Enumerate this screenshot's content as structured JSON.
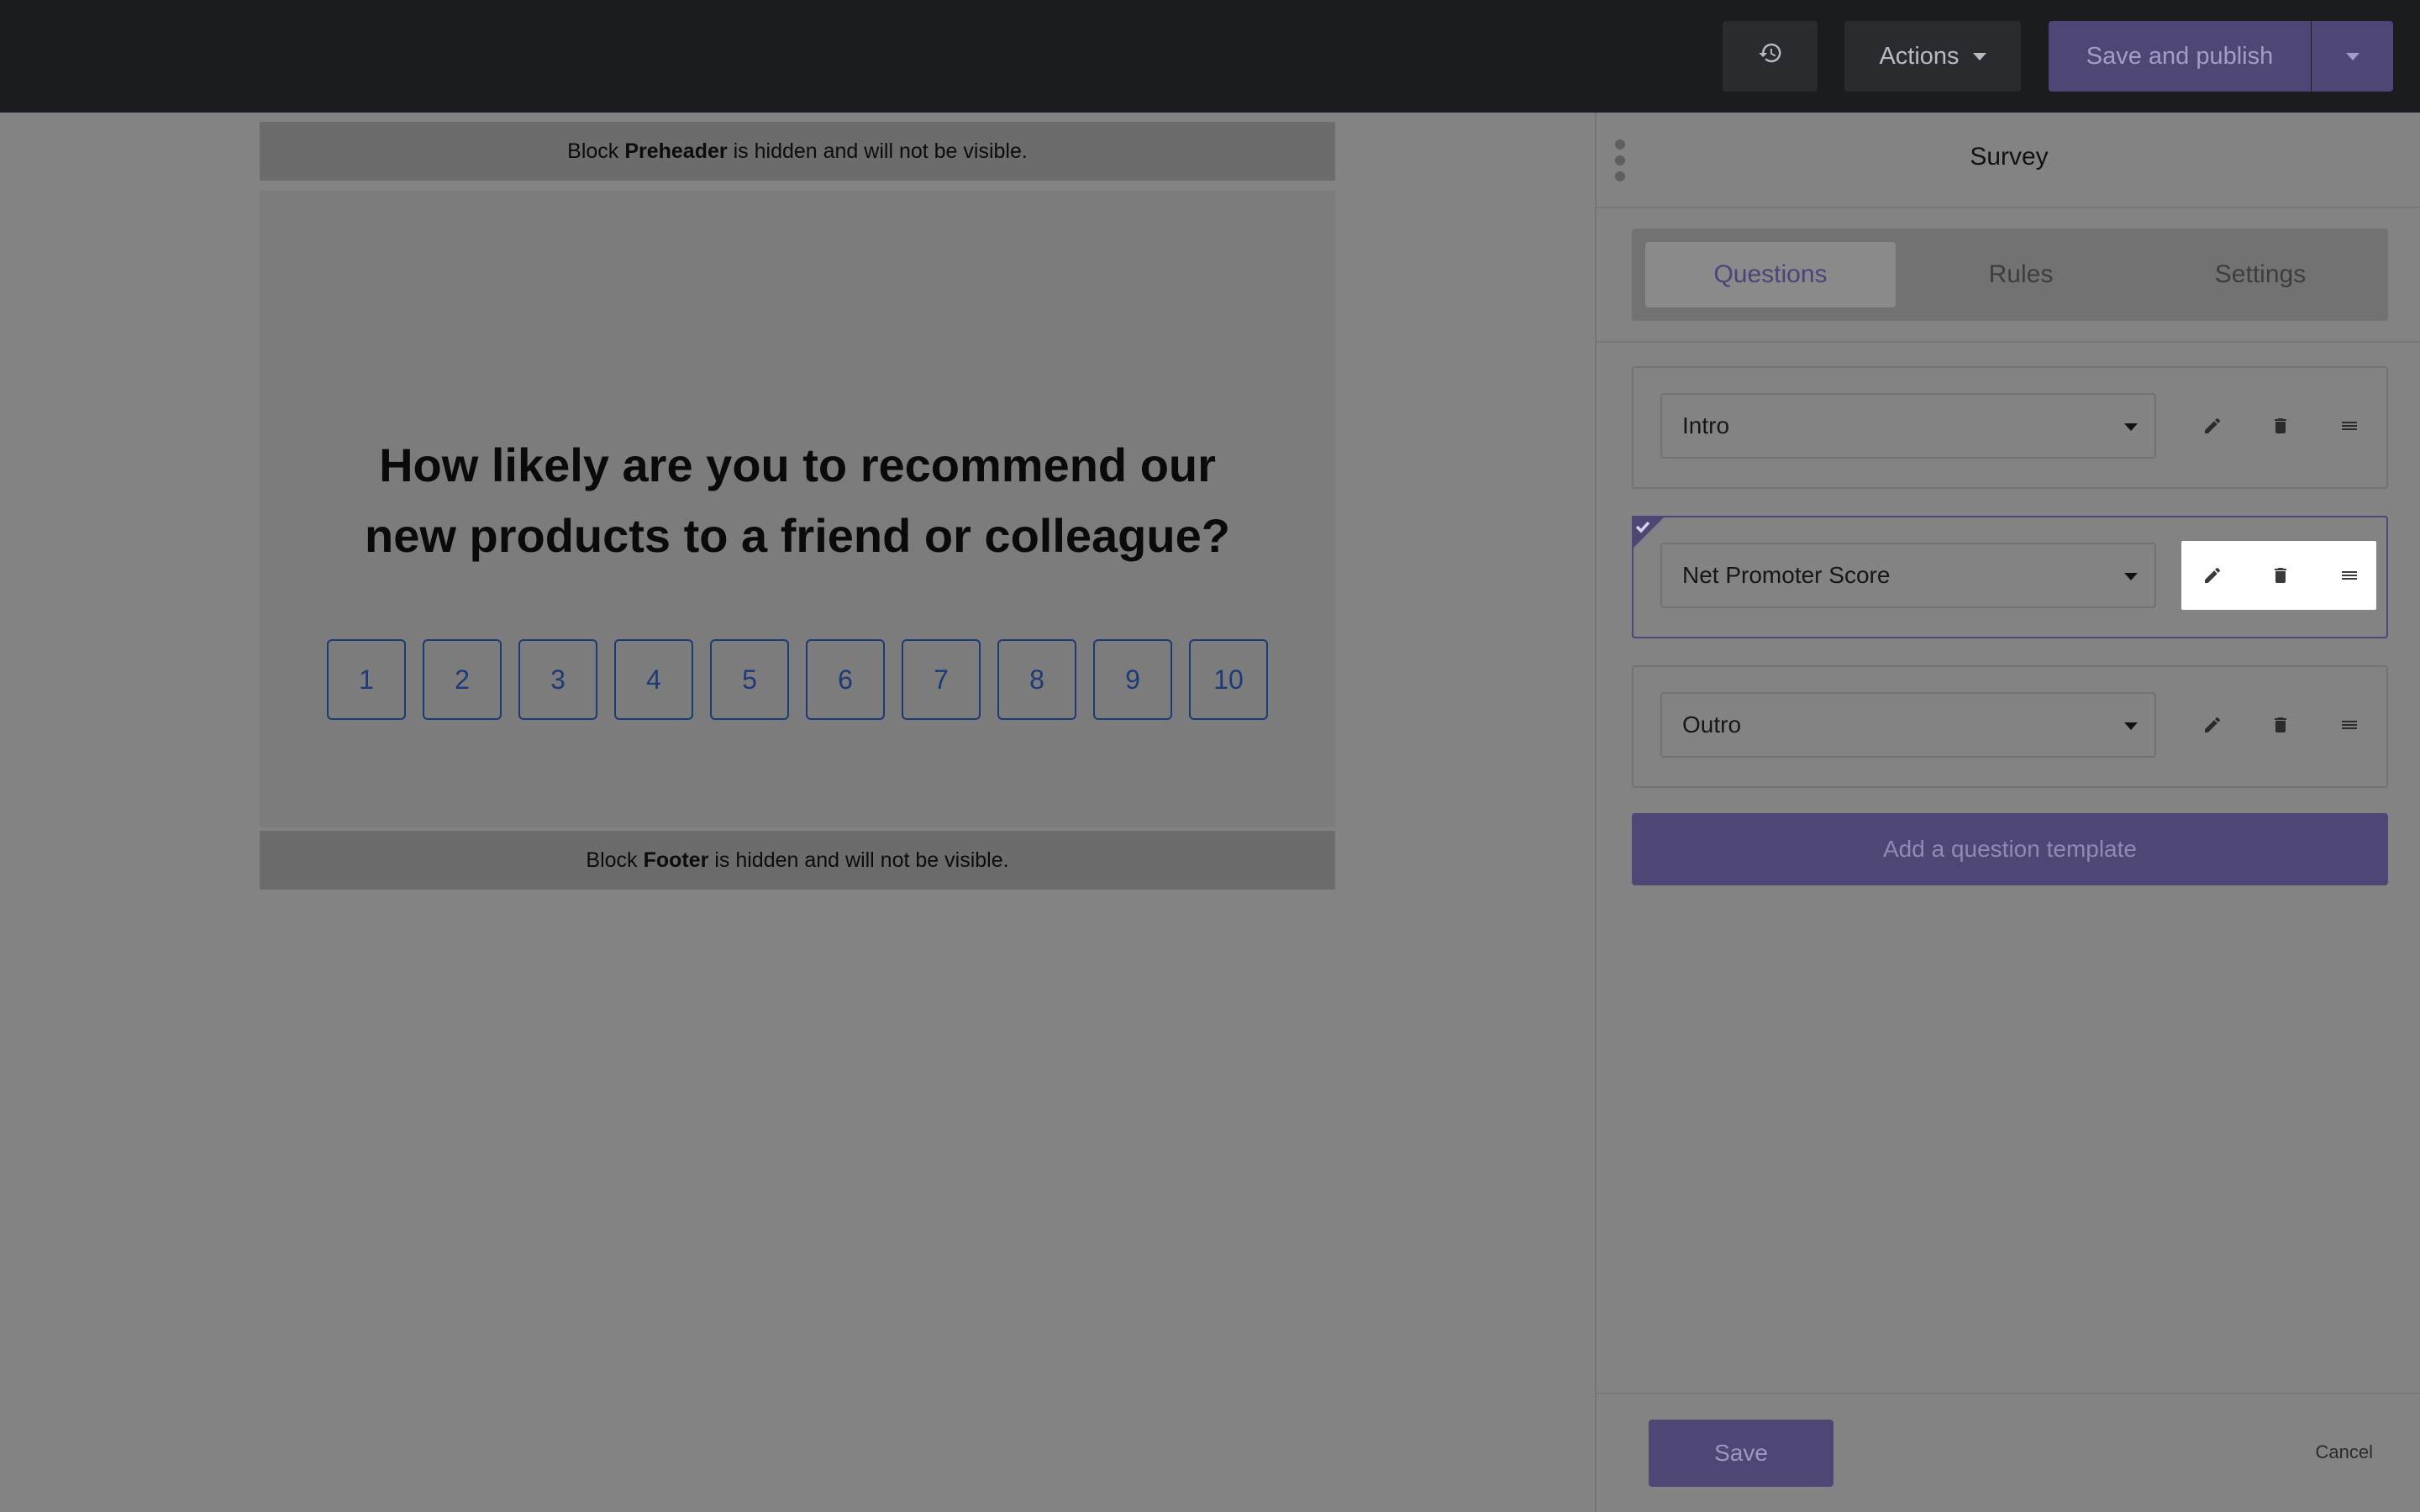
{
  "topbar": {
    "history_icon": "history-icon",
    "actions_label": "Actions",
    "publish_label": "Save and publish"
  },
  "canvas": {
    "preheader": {
      "prefix": "Block",
      "block": "Preheader",
      "suffix": "is hidden and will not be visible."
    },
    "question_line1": "How likely are you to recommend our",
    "question_line2": "new products to a friend or colleague?",
    "scale": [
      "1",
      "2",
      "3",
      "4",
      "5",
      "6",
      "7",
      "8",
      "9",
      "10"
    ],
    "footer": {
      "prefix": "Block",
      "block": "Footer",
      "suffix": "is hidden and will not be visible."
    }
  },
  "sidebar": {
    "title": "Survey",
    "tabs": [
      {
        "label": "Questions",
        "active": true
      },
      {
        "label": "Rules",
        "active": false
      },
      {
        "label": "Settings",
        "active": false
      }
    ],
    "questions": [
      {
        "label": "Intro",
        "selected": false
      },
      {
        "label": "Net Promoter Score",
        "selected": true
      },
      {
        "label": "Outro",
        "selected": false
      }
    ],
    "add_template_label": "Add a question template",
    "save_label": "Save",
    "cancel_label": "Cancel"
  },
  "colors": {
    "accent": "#4e4674",
    "scale_border": "#1d3a78",
    "topbar": "#1b1c1f"
  }
}
